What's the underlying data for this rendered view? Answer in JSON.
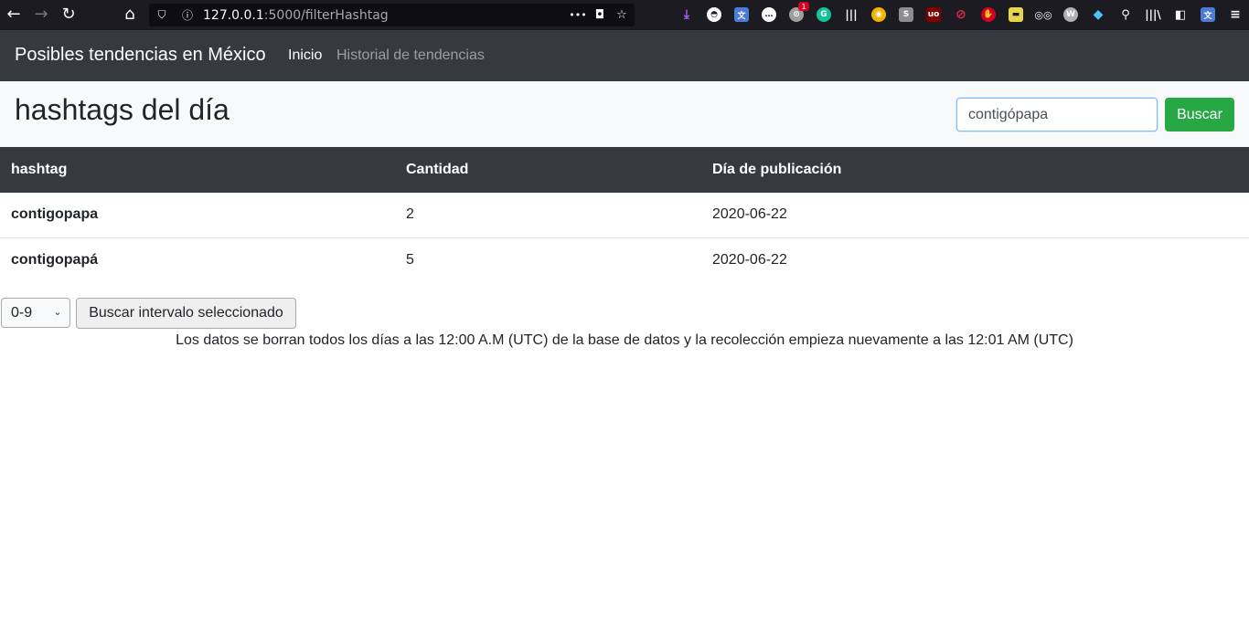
{
  "browser": {
    "url_host": "127.0.0.1",
    "url_rest": ":5000/filterHashtag",
    "more_dots": "•••",
    "extension_badge": "1"
  },
  "navbar": {
    "brand": "Posibles tendencias en México",
    "links": [
      {
        "label": "Inicio"
      },
      {
        "label": "Historial de tendencias"
      }
    ]
  },
  "header": {
    "title": "hashtags del día",
    "search_value": "contigópapa",
    "search_button": "Buscar"
  },
  "table": {
    "columns": [
      "hashtag",
      "Cantidad",
      "Día de publicación"
    ],
    "rows": [
      {
        "hashtag": "contigopapa",
        "cantidad": "2",
        "dia": "2020-06-22"
      },
      {
        "hashtag": "contigopapá",
        "cantidad": "5",
        "dia": "2020-06-22"
      }
    ]
  },
  "interval": {
    "selected": "0-9",
    "button": "Buscar intervalo seleccionado"
  },
  "footer_note": "Los datos se borran todos los días a las 12:00 A.M (UTC) de la base de datos y la recolección empieza nuevamente a las 12:01 AM (UTC)",
  "colors": {
    "navbar_bg": "#343a40",
    "success": "#28a745",
    "header_bg": "#f8f9fa"
  }
}
